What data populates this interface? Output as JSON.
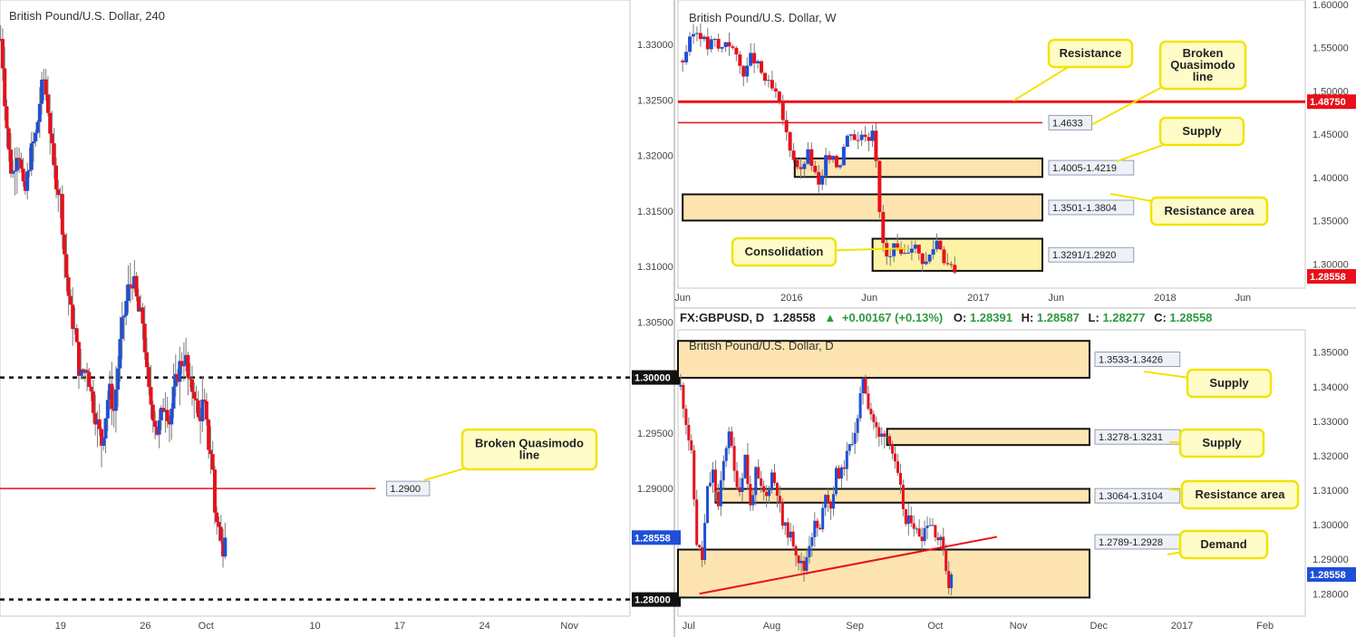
{
  "colors": {
    "bull": "#1f4fd6",
    "bear": "#e8101a",
    "zone_fill": "#fde4b0",
    "callout_fill": "#fffcc8",
    "callout_border": "#f2e300",
    "red_line": "#e8101a",
    "grid": "#ffffff"
  },
  "chart_data": [
    {
      "id": "h4",
      "type": "candlestick",
      "title": "British Pound/U.S. Dollar, 240",
      "ylim": [
        1.2785,
        1.334
      ],
      "y_ticks": [
        "1.33000",
        "1.32500",
        "1.32000",
        "1.31500",
        "1.31000",
        "1.30500",
        "1.30000",
        "1.29500",
        "1.29000",
        "1.28558",
        "1.28000"
      ],
      "x_ticks": [
        "19",
        "26",
        "Oct",
        "10",
        "17",
        "24",
        "Nov"
      ],
      "x_tick_days": [
        3,
        10,
        15,
        24,
        31,
        38,
        45
      ],
      "day_range": [
        -2,
        50
      ],
      "levels": [
        {
          "name": "1.30000",
          "value": 1.3,
          "style": "dashed-black"
        },
        {
          "name": "1.2900",
          "value": 1.29,
          "style": "red",
          "x_end_day": 29
        },
        {
          "name": "1.28000",
          "value": 1.28,
          "style": "dashed-black"
        }
      ],
      "last_price": "1.28558",
      "callouts": [
        {
          "text": "Broken Quasimodo line",
          "lines": [
            "Broken Quasimodo",
            "line"
          ]
        }
      ],
      "close_path": [
        [
          -1.9,
          1.3305
        ],
        [
          -1.6,
          1.325
        ],
        [
          -1.3,
          1.3205
        ],
        [
          -1,
          1.318
        ],
        [
          -0.5,
          1.321
        ],
        [
          0,
          1.316
        ],
        [
          0.5,
          1.32
        ],
        [
          1,
          1.322
        ],
        [
          1.3,
          1.325
        ],
        [
          1.6,
          1.327
        ],
        [
          2,
          1.324
        ],
        [
          2.4,
          1.319
        ],
        [
          2.8,
          1.317
        ],
        [
          3,
          1.316
        ],
        [
          3.4,
          1.31
        ],
        [
          3.8,
          1.306
        ],
        [
          4.2,
          1.304
        ],
        [
          4.6,
          1.3
        ],
        [
          5.2,
          1.301
        ],
        [
          5.6,
          1.298
        ],
        [
          6,
          1.296
        ],
        [
          6.4,
          1.294
        ],
        [
          7,
          1.299
        ],
        [
          7.4,
          1.297
        ],
        [
          8,
          1.304
        ],
        [
          8.6,
          1.308
        ],
        [
          9,
          1.309
        ],
        [
          9.4,
          1.306
        ],
        [
          9.8,
          1.305
        ],
        [
          10.2,
          1.299
        ],
        [
          10.6,
          1.297
        ],
        [
          11,
          1.295
        ],
        [
          11.6,
          1.298
        ],
        [
          12,
          1.296
        ],
        [
          12.4,
          1.299
        ],
        [
          12.8,
          1.301
        ],
        [
          13.3,
          1.302
        ],
        [
          13.6,
          1.299
        ],
        [
          14,
          1.299
        ],
        [
          14.4,
          1.296
        ],
        [
          14.8,
          1.298
        ],
        [
          15.2,
          1.294
        ],
        [
          15.5,
          1.293
        ],
        [
          15.7,
          1.288
        ],
        [
          16,
          1.287
        ],
        [
          16.3,
          1.2845
        ],
        [
          16.5,
          1.285
        ],
        [
          16.7,
          1.28558
        ]
      ]
    },
    {
      "id": "weekly",
      "type": "candlestick",
      "title": "British Pound/U.S. Dollar, W",
      "ylim": [
        1.272,
        1.605
      ],
      "y_ticks": [
        "1.60000",
        "1.55000",
        "1.50000",
        "1.45000",
        "1.40000",
        "1.35000",
        "1.30000"
      ],
      "x_ticks": [
        "Jun",
        "2016",
        "Jun",
        "2017",
        "Jun",
        "2018",
        "Jun"
      ],
      "x_tick_months": [
        0,
        7,
        12,
        19,
        24,
        31,
        36
      ],
      "month_range": [
        -0.3,
        40
      ],
      "levels": [
        {
          "name": "1.48750",
          "value": 1.4875,
          "style": "red-thick",
          "label": "1.48750"
        },
        {
          "name": "1.4633",
          "value": 1.4633,
          "style": "red",
          "label": "1.4633"
        }
      ],
      "zones": [
        {
          "label": "1.4005-1.4219",
          "low": 1.4005,
          "high": 1.4219,
          "from_month": 7.2
        },
        {
          "label": "1.3501-1.3804",
          "low": 1.3501,
          "high": 1.3804,
          "from_month": 0
        },
        {
          "label": "1.3291/1.2920",
          "low": 1.292,
          "high": 1.3291,
          "from_month": 12.2,
          "yellow": true
        }
      ],
      "last_price": "1.28558",
      "callouts": [
        {
          "text": "Resistance",
          "lines": [
            "Resistance"
          ]
        },
        {
          "text": "Broken Quasimodo line",
          "lines": [
            "Broken",
            "Quasimodo",
            "line"
          ]
        },
        {
          "text": "Supply",
          "lines": [
            "Supply"
          ]
        },
        {
          "text": "Resistance area",
          "lines": [
            "Resistance area"
          ]
        },
        {
          "text": "Consolidation",
          "lines": [
            "Consolidation"
          ]
        }
      ],
      "close_path": [
        [
          0,
          1.535
        ],
        [
          0.4,
          1.555
        ],
        [
          0.8,
          1.57
        ],
        [
          1.2,
          1.565
        ],
        [
          1.6,
          1.55
        ],
        [
          2,
          1.56
        ],
        [
          2.4,
          1.545
        ],
        [
          2.8,
          1.56
        ],
        [
          3.2,
          1.55
        ],
        [
          3.6,
          1.53
        ],
        [
          4,
          1.52
        ],
        [
          4.4,
          1.54
        ],
        [
          4.8,
          1.53
        ],
        [
          5.2,
          1.515
        ],
        [
          5.6,
          1.505
        ],
        [
          6,
          1.495
        ],
        [
          6.4,
          1.47
        ],
        [
          6.8,
          1.44
        ],
        [
          7.2,
          1.42
        ],
        [
          7.6,
          1.405
        ],
        [
          8,
          1.43
        ],
        [
          8.4,
          1.41
        ],
        [
          8.8,
          1.385
        ],
        [
          9.2,
          1.42
        ],
        [
          9.6,
          1.43
        ],
        [
          10,
          1.41
        ],
        [
          10.4,
          1.44
        ],
        [
          10.8,
          1.455
        ],
        [
          11.2,
          1.44
        ],
        [
          11.6,
          1.455
        ],
        [
          12,
          1.445
        ],
        [
          12.2,
          1.46
        ],
        [
          12.4,
          1.43
        ],
        [
          12.6,
          1.365
        ],
        [
          12.8,
          1.33
        ],
        [
          13.2,
          1.3
        ],
        [
          13.6,
          1.32
        ],
        [
          14,
          1.305
        ],
        [
          14.4,
          1.315
        ],
        [
          14.8,
          1.325
        ],
        [
          15.2,
          1.31
        ],
        [
          15.6,
          1.3
        ],
        [
          16,
          1.315
        ],
        [
          16.4,
          1.33
        ],
        [
          16.8,
          1.305
        ],
        [
          17.2,
          1.295
        ],
        [
          17.6,
          1.29
        ]
      ]
    },
    {
      "id": "daily",
      "type": "candlestick",
      "title": "British Pound/U.S. Dollar, D",
      "symbol_line": {
        "symbol": "FX:GBPUSD, D",
        "price": "1.28558",
        "change": "+0.00167 (+0.13%)",
        "o_label": "O:",
        "o": "1.28391",
        "h_label": "H:",
        "h": "1.28587",
        "l_label": "L:",
        "l": "1.28277",
        "c_label": "C:",
        "c": "1.28558"
      },
      "ylim": [
        1.2735,
        1.3565
      ],
      "y_ticks": [
        "1.35000",
        "1.34000",
        "1.33000",
        "1.32000",
        "1.31000",
        "1.30000",
        "1.29000",
        "1.28558",
        "1.28000"
      ],
      "x_ticks": [
        "Jul",
        "Aug",
        "Sep",
        "Oct",
        "Nov",
        "Dec",
        "2017",
        "Feb"
      ],
      "x_tick_days": [
        0,
        31,
        62,
        92,
        123,
        153,
        184,
        215
      ],
      "day_range": [
        -4,
        230
      ],
      "zones": [
        {
          "label": "1.3533-1.3426",
          "low": 1.3426,
          "high": 1.3533,
          "from_day": -4
        },
        {
          "label": "1.3278-1.3231",
          "low": 1.3231,
          "high": 1.3278,
          "from_day": 74
        },
        {
          "label": "1.3064-1.3104",
          "low": 1.3064,
          "high": 1.3104,
          "from_day": 10
        },
        {
          "label": "1.2789-1.2928",
          "low": 1.2789,
          "high": 1.2928,
          "from_day": -4
        }
      ],
      "trendline": {
        "from": [
          4,
          1.28
        ],
        "to": [
          115,
          1.2965
        ]
      },
      "last_price": "1.28558",
      "callouts": [
        {
          "text": "Supply",
          "lines": [
            "Supply"
          ]
        },
        {
          "text": "Supply",
          "lines": [
            "Supply"
          ]
        },
        {
          "text": "Resistance area",
          "lines": [
            "Resistance area"
          ]
        },
        {
          "text": "Demand",
          "lines": [
            "Demand"
          ]
        }
      ],
      "close_path": [
        [
          -3,
          1.34
        ],
        [
          -1,
          1.33
        ],
        [
          1,
          1.32
        ],
        [
          3,
          1.295
        ],
        [
          5,
          1.29
        ],
        [
          7,
          1.31
        ],
        [
          9,
          1.315
        ],
        [
          11,
          1.305
        ],
        [
          13,
          1.318
        ],
        [
          15,
          1.328
        ],
        [
          17,
          1.315
        ],
        [
          19,
          1.31
        ],
        [
          21,
          1.32
        ],
        [
          23,
          1.305
        ],
        [
          25,
          1.315
        ],
        [
          27,
          1.31
        ],
        [
          29,
          1.308
        ],
        [
          31,
          1.315
        ],
        [
          33,
          1.31
        ],
        [
          35,
          1.3
        ],
        [
          37,
          1.298
        ],
        [
          39,
          1.295
        ],
        [
          41,
          1.29
        ],
        [
          43,
          1.287
        ],
        [
          45,
          1.295
        ],
        [
          47,
          1.3
        ],
        [
          49,
          1.298
        ],
        [
          51,
          1.31
        ],
        [
          53,
          1.305
        ],
        [
          55,
          1.315
        ],
        [
          57,
          1.315
        ],
        [
          59,
          1.32
        ],
        [
          61,
          1.325
        ],
        [
          63,
          1.33
        ],
        [
          65,
          1.343
        ],
        [
          67,
          1.335
        ],
        [
          69,
          1.33
        ],
        [
          71,
          1.325
        ],
        [
          73,
          1.327
        ],
        [
          75,
          1.325
        ],
        [
          77,
          1.317
        ],
        [
          79,
          1.31
        ],
        [
          81,
          1.3
        ],
        [
          83,
          1.302
        ],
        [
          85,
          1.298
        ],
        [
          87,
          1.297
        ],
        [
          89,
          1.301
        ],
        [
          91,
          1.3
        ],
        [
          93,
          1.296
        ],
        [
          95,
          1.294
        ],
        [
          96,
          1.287
        ],
        [
          97,
          1.283
        ],
        [
          98,
          1.28558
        ]
      ]
    }
  ]
}
